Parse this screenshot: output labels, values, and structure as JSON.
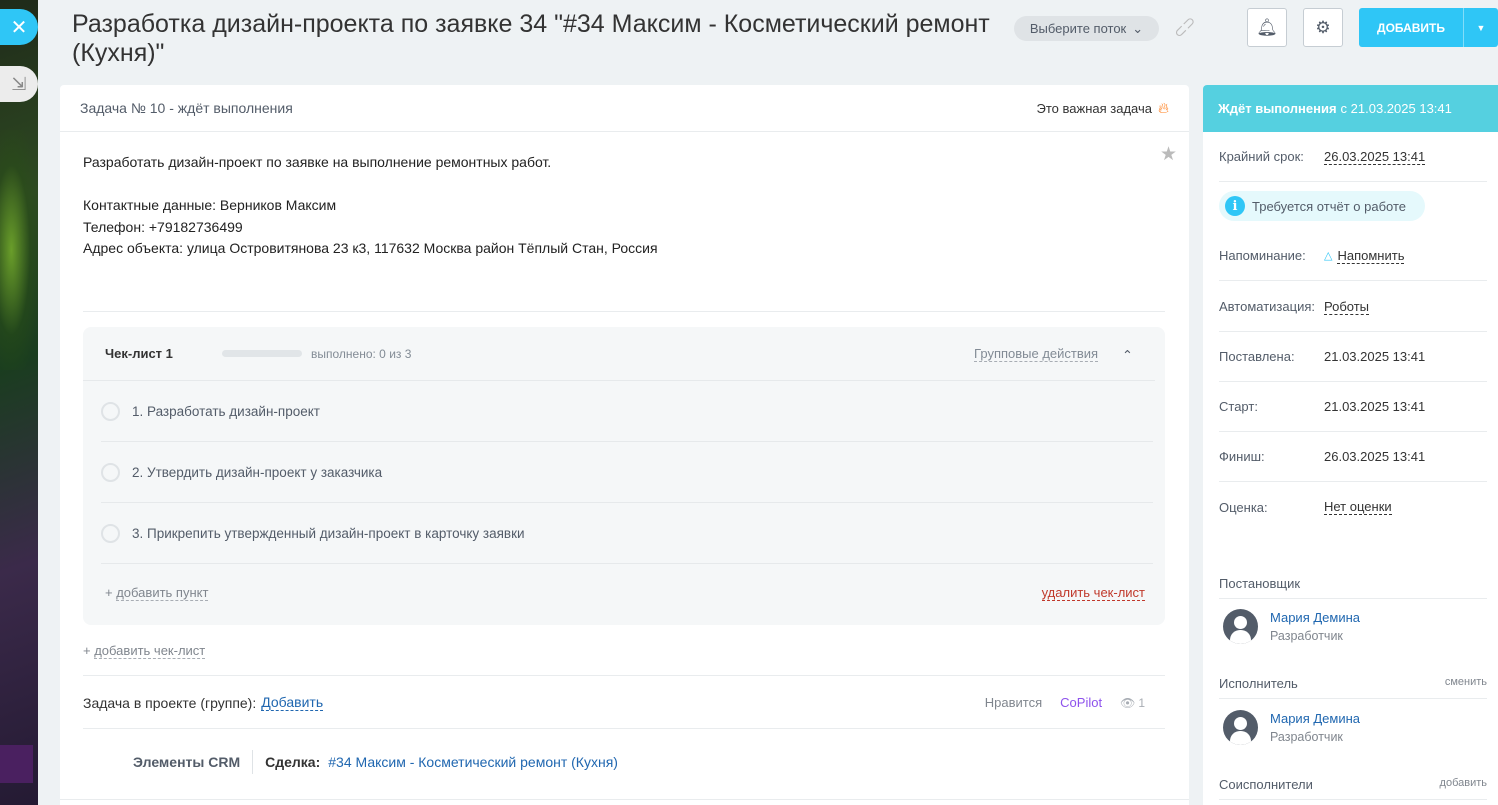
{
  "window": {
    "close_icon": "close-icon",
    "minimize_icon": "minimize-icon"
  },
  "header": {
    "title": "Разработка дизайн-проекта по заявке 34 \"#34 Максим - Косметический ремонт (Кухня)\"",
    "flow_label": "Выберите поток",
    "add_label": "ДОБАВИТЬ",
    "accent_color": "#2fc6f6"
  },
  "task": {
    "number_status": "Задача № 10 - ждёт выполнения",
    "important_label": "Это важная задача",
    "description": [
      "Разработать дизайн-проект по заявке на выполнение ремонтных работ.",
      "",
      "Контактные данные: Верников Максим",
      "Телефон: +79182736499",
      "Адрес объекта: улица Островитянова 23 к3, 117632 Москва район Тёплый Стан, Россия"
    ]
  },
  "checklist": {
    "title": "Чек-лист 1",
    "progress_text": "выполнено: 0 из 3",
    "progress_fraction": 0,
    "group_actions": "Групповые действия",
    "items": [
      {
        "text": "1. Разработать дизайн-проект",
        "checked": false
      },
      {
        "text": "2. Утвердить дизайн-проект у заказчика",
        "checked": false
      },
      {
        "text": "3. Прикрепить утвержденный дизайн-проект в карточку заявки",
        "checked": false
      }
    ],
    "add_item_prefix": "+",
    "add_item": "добавить пункт",
    "delete": "удалить чек-лист",
    "add_checklist_prefix": "+",
    "add_checklist": "добавить чек-лист"
  },
  "project": {
    "label": "Задача в проекте (группе):",
    "add": "Добавить",
    "like": "Нравится",
    "copilot": "CoPilot",
    "views": "1"
  },
  "crm": {
    "label": "Элементы CRM",
    "deal_label": "Сделка:",
    "deal_link": "#34 Максим - Косметический ремонт (Кухня)"
  },
  "sidebar": {
    "status_bold": "Ждёт выполнения",
    "status_rest": "с 21.03.2025 13:41",
    "deadline_label": "Крайний срок:",
    "deadline_value": "26.03.2025 13:41",
    "report_text": "Требуется отчёт о работе",
    "reminder_label": "Напоминание:",
    "reminder_value": "Напомнить",
    "automation_label": "Автоматизация:",
    "automation_value": "Роботы",
    "created_label": "Поставлена:",
    "created_value": "21.03.2025 13:41",
    "start_label": "Старт:",
    "start_value": "21.03.2025 13:41",
    "finish_label": "Финиш:",
    "finish_value": "26.03.2025 13:41",
    "rating_label": "Оценка:",
    "rating_value": "Нет оценки",
    "creator_title": "Постановщик",
    "creator_name": "Мария Демина",
    "creator_role": "Разработчик",
    "assignee_title": "Исполнитель",
    "assignee_action": "сменить",
    "assignee_name": "Мария Демина",
    "assignee_role": "Разработчик",
    "coassignees_title": "Соисполнители",
    "coassignees_action": "добавить"
  }
}
